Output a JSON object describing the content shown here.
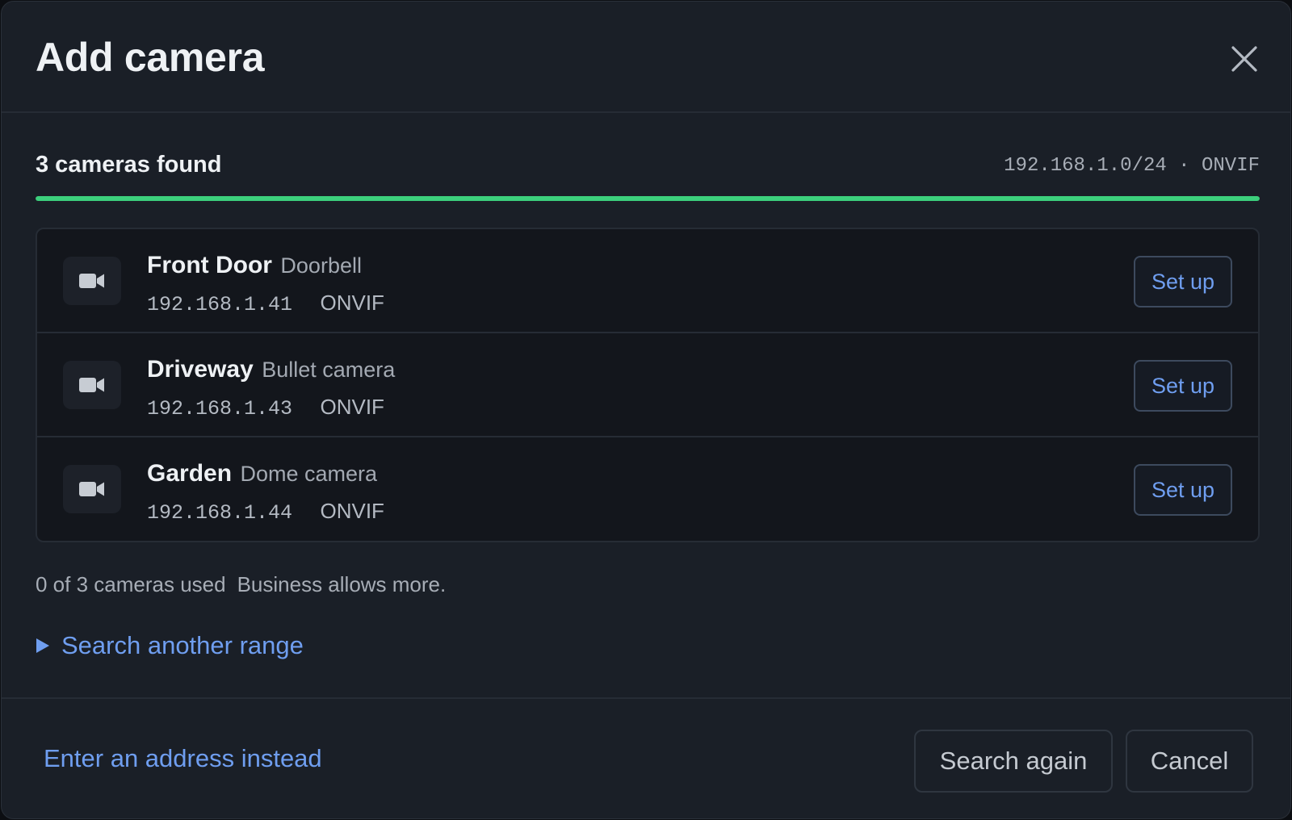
{
  "dialog": {
    "title": "Add camera",
    "close_icon": "close-icon"
  },
  "scan": {
    "found_label": "3 cameras found",
    "meta": "192.168.1.0/24 · ONVIF",
    "progress_fraction": 1.0,
    "progress_color": "#3ccf7c"
  },
  "cameras": [
    {
      "name": "Front Door",
      "type": "Doorbell",
      "ip": "192.168.1.41",
      "protocol": "ONVIF",
      "action": "Set up",
      "icon": "video-camera-icon"
    },
    {
      "name": "Driveway",
      "type": "Bullet camera",
      "ip": "192.168.1.43",
      "protocol": "ONVIF",
      "action": "Set up",
      "icon": "video-camera-icon"
    },
    {
      "name": "Garden",
      "type": "Dome camera",
      "ip": "192.168.1.44",
      "protocol": "ONVIF",
      "action": "Set up",
      "icon": "video-camera-icon"
    }
  ],
  "usage": {
    "count": "0 of 3 cameras used",
    "upsell": "Business allows more."
  },
  "search_range": {
    "label": "Search another range",
    "icon": "triangle-right-icon"
  },
  "footer": {
    "enter_address": "Enter an address instead",
    "search_again": "Search again",
    "cancel": "Cancel"
  },
  "colors": {
    "accent": "#6f9ef0",
    "success": "#3ccf7c",
    "background": "#1a1f27"
  }
}
